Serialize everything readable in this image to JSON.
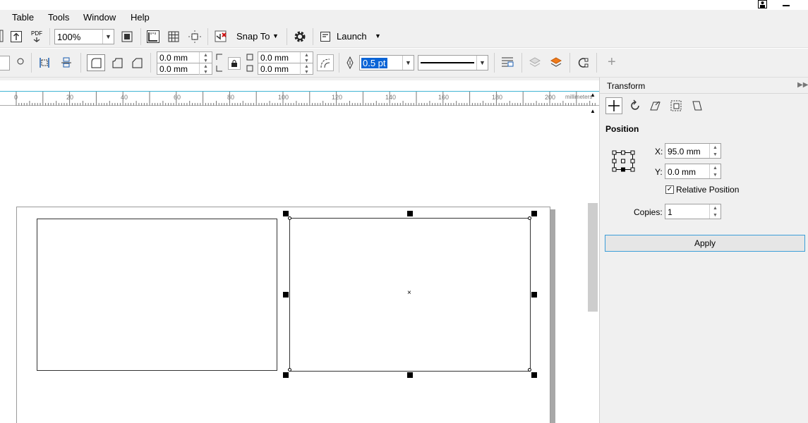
{
  "window": {
    "user_icon": "user-icon",
    "minimize_icon": "minimize-icon"
  },
  "menu": {
    "items": [
      "Table",
      "Tools",
      "Window",
      "Help"
    ]
  },
  "toolbar1": {
    "zoom_value": "100%",
    "pdf_label": "PDF",
    "snap_label": "Snap To",
    "launch_label": "Launch"
  },
  "toolbar2": {
    "offset_x": "0.0 mm",
    "offset_y": "0.0 mm",
    "corner_x": "0.0 mm",
    "corner_y": "0.0 mm",
    "outline_width": "0.5 pt",
    "add_label": "+"
  },
  "ruler": {
    "ticks": [
      "0",
      "20",
      "40",
      "60",
      "80",
      "100",
      "120",
      "140",
      "160",
      "180",
      "200"
    ],
    "units": "millimeters"
  },
  "docker": {
    "title": "Transform",
    "section": "Position",
    "x_label": "X:",
    "x_value": "95.0 mm",
    "y_label": "Y:",
    "y_value": "0.0 mm",
    "relative_label": "Relative Position",
    "relative_checked": true,
    "copies_label": "Copies:",
    "copies_value": "1",
    "apply_label": "Apply"
  },
  "colors": {
    "accent": "#3fb5d4",
    "selection_text_bg": "#0a64d6",
    "launch_icon": "#333333"
  }
}
